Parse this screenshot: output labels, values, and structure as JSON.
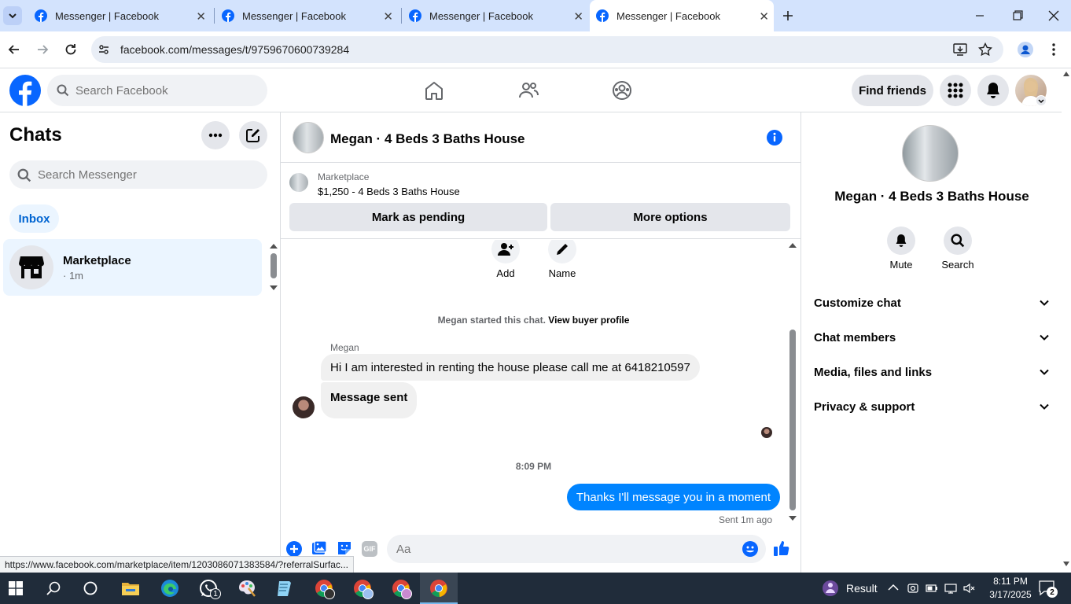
{
  "browser": {
    "tabs": [
      {
        "title": "Messenger | Facebook",
        "active": false
      },
      {
        "title": "Messenger | Facebook",
        "active": false
      },
      {
        "title": "Messenger | Facebook",
        "active": false
      },
      {
        "title": "Messenger | Facebook",
        "active": true
      }
    ],
    "url": "facebook.com/messages/t/9759670600739284",
    "status_url": "https://www.facebook.com/marketplace/item/1203086071383584/?referralSurfac..."
  },
  "header": {
    "search_placeholder": "Search Facebook",
    "find_friends": "Find friends"
  },
  "chats": {
    "title": "Chats",
    "search_placeholder": "Search Messenger",
    "inbox_label": "Inbox",
    "items": [
      {
        "name": "Marketplace",
        "meta": "· 1m"
      }
    ]
  },
  "conversation": {
    "title": "Megan · 4 Beds 3 Baths House",
    "marketplace_label": "Marketplace",
    "listing": "$1,250 - 4 Beds 3 Baths House",
    "mark_pending": "Mark as pending",
    "more_options": "More options",
    "add_label": "Add",
    "name_label": "Name",
    "started_text": "Megan started this chat.",
    "view_buyer": "View buyer profile",
    "sender_name": "Megan",
    "msg1": "Hi I am interested in renting the house please call me at 6418210597",
    "msg2": "Message sent",
    "time_divider": "8:09 PM",
    "msg3": "Thanks I'll message you in a moment",
    "sent_status": "Sent 1m ago",
    "composer_placeholder": "Aa"
  },
  "profile": {
    "name": "Megan · 4 Beds 3 Baths House",
    "mute": "Mute",
    "search": "Search",
    "sections": [
      "Customize chat",
      "Chat members",
      "Media, files and links",
      "Privacy & support"
    ]
  },
  "taskbar": {
    "result": "Result",
    "time": "8:11 PM",
    "date": "3/17/2025",
    "notif_count": "2",
    "whatsapp_badge": "1"
  },
  "colors": {
    "fb_blue": "#0866ff",
    "messenger_blue": "#0084ff",
    "selected_chat": "#ebf5ff"
  }
}
